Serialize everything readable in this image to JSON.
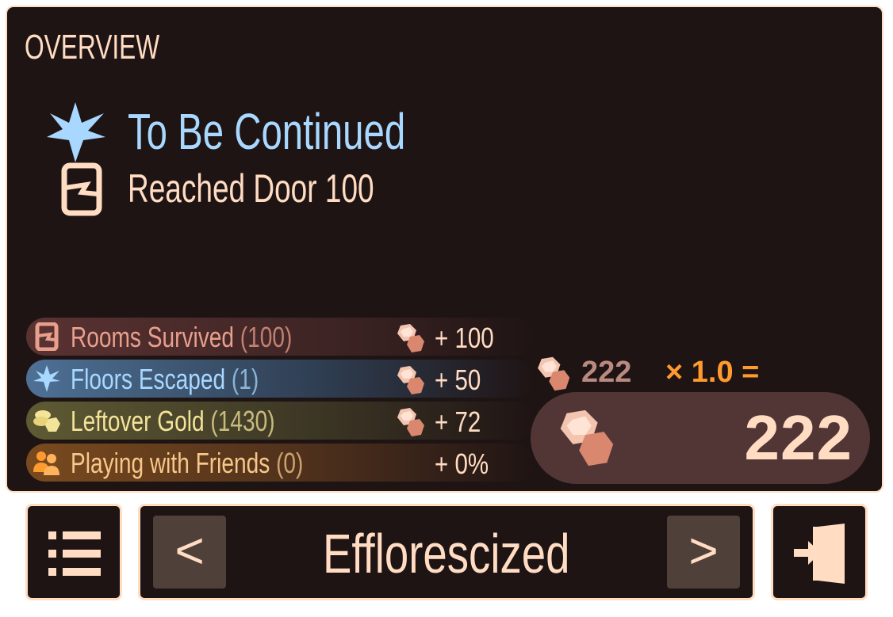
{
  "overview": {
    "title": "OVERVIEW",
    "result_title": "To Be Continued",
    "result_subtitle": "Reached Door 100"
  },
  "stats": [
    {
      "label": "Rooms Survived",
      "count": "(100)",
      "value": "+ 100",
      "icon": "door-icon",
      "has_gem": true
    },
    {
      "label": "Floors Escaped",
      "count": "(1)",
      "value": "+ 50",
      "icon": "star-icon",
      "has_gem": true
    },
    {
      "label": "Leftover Gold",
      "count": "(1430)",
      "value": "+ 72",
      "icon": "gold-coins-icon",
      "has_gem": true
    },
    {
      "label": "Playing with Friends",
      "count": "(0)",
      "value": "+ 0%",
      "icon": "friends-icon",
      "has_gem": false
    }
  ],
  "summary": {
    "subtotal": "222",
    "multiplier": "× 1.0 =",
    "total": "222"
  },
  "bottom_bar": {
    "room_name": "Efflorescized",
    "prev_label": "<",
    "next_label": ">"
  },
  "colors": {
    "panel_bg": "#1f1414",
    "accent_cream": "#ffdcc2",
    "blue": "#a8d8ff",
    "orange": "#ff9a2e",
    "rooms_text": "#e8a08c",
    "gold_text": "#f4e49a"
  }
}
